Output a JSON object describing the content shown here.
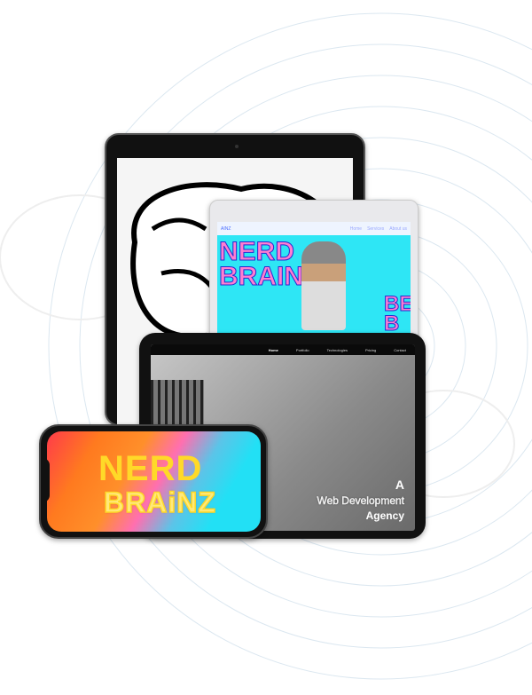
{
  "tablet": {
    "brand": "AINZ",
    "nav": [
      "Home",
      "Services",
      "About us"
    ],
    "hero_line1": "NERD",
    "hero_line2": "BRAINZ",
    "side_text": "BE BOL"
  },
  "laptop": {
    "nav": [
      "Home",
      "Portfolio",
      "Technologies",
      "Pricing",
      "Contact"
    ],
    "hero": {
      "line1": "A",
      "line2": "Web Development",
      "line3": "Agency"
    }
  },
  "phone": {
    "title_line1": "NERD",
    "title_line2": "BRAiNZ"
  },
  "colors": {
    "yellow": "#ffd928",
    "cyan": "#22e0f5",
    "pink": "#ff6fb0",
    "orange": "#ff8f2a"
  }
}
